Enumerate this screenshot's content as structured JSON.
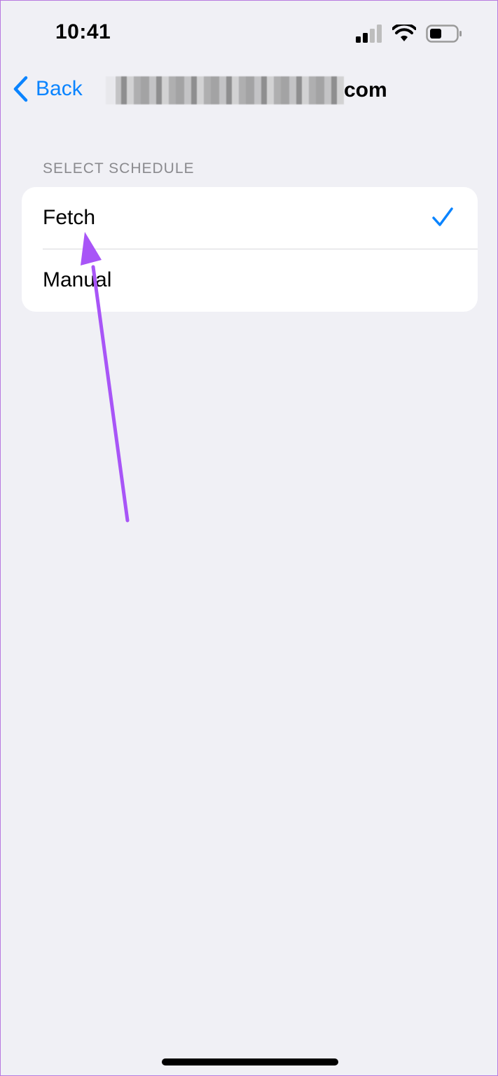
{
  "status_bar": {
    "time": "10:41",
    "icons": [
      "signal-icon",
      "wifi-icon",
      "battery-icon"
    ]
  },
  "nav": {
    "back_label": "Back",
    "title_suffix": "com",
    "accent_color": "#0a84ff"
  },
  "section": {
    "header": "SELECT SCHEDULE",
    "options": [
      {
        "label": "Fetch",
        "selected": true
      },
      {
        "label": "Manual",
        "selected": false
      }
    ]
  },
  "annotation": {
    "color": "#a855f7",
    "points_to": "Fetch"
  }
}
